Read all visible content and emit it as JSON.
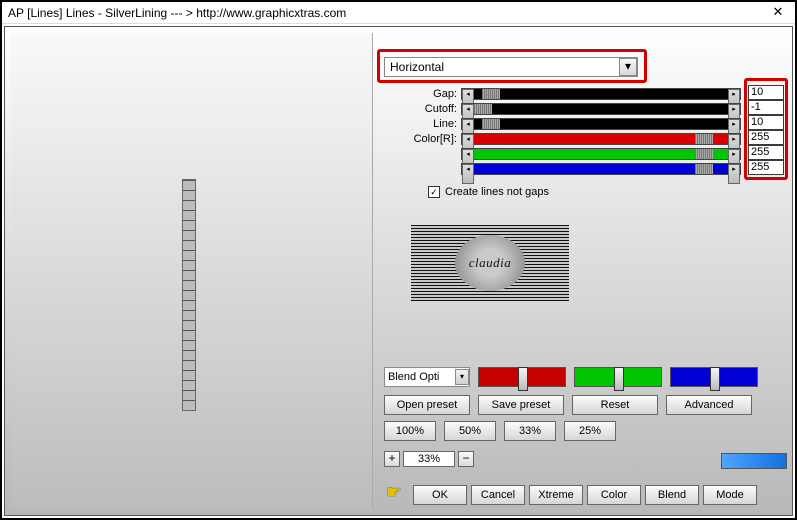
{
  "window": {
    "title": "AP [Lines]  Lines - SilverLining    --- >  http://www.graphicxtras.com"
  },
  "dropdown": {
    "selected": "Horizontal"
  },
  "sliders": {
    "gap": {
      "label": "Gap:",
      "value": "10",
      "track": "#000000",
      "thumb_pct": 3
    },
    "cutoff": {
      "label": "Cutoff:",
      "value": "-1",
      "track": "#000000",
      "thumb_pct": 0
    },
    "line": {
      "label": "Line:",
      "value": "10",
      "track": "#000000",
      "thumb_pct": 3
    },
    "r": {
      "label": "Color[R]:",
      "value": "255",
      "track": "#d80000",
      "thumb_pct": 94
    },
    "g": {
      "label": "",
      "value": "255",
      "track": "#00c800",
      "thumb_pct": 94
    },
    "b": {
      "label": "",
      "value": "255",
      "track": "#0000d8",
      "thumb_pct": 94
    }
  },
  "checkbox": {
    "label": "Create lines not gaps",
    "checked": true
  },
  "logo": {
    "text": "claudia"
  },
  "blend_options": {
    "label": "Blend Opti"
  },
  "preset_row": {
    "open": "Open preset",
    "save": "Save preset",
    "reset": "Reset",
    "advanced": "Advanced"
  },
  "zoom_presets": {
    "p100": "100%",
    "p50": "50%",
    "p33": "33%",
    "p25": "25%"
  },
  "zoom": {
    "value": "33%"
  },
  "footer_btns": {
    "ok": "OK",
    "cancel": "Cancel",
    "xtreme": "Xtreme",
    "color": "Color",
    "blend": "Blend",
    "mode": "Mode"
  }
}
